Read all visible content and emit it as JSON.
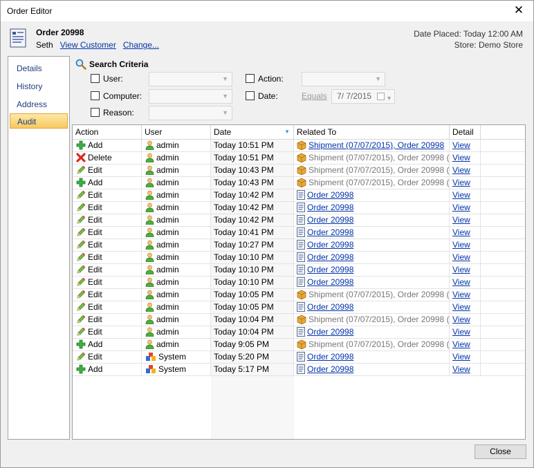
{
  "window": {
    "title": "Order Editor",
    "close_glyph": "✕"
  },
  "header": {
    "order_title": "Order 20998",
    "customer_name": "Seth",
    "view_customer": "View Customer",
    "change": "Change...",
    "date_placed": "Date Placed: Today 12:00 AM",
    "store": "Store: Demo Store",
    "icon": "order-document-icon"
  },
  "nav": {
    "items": [
      {
        "label": "Details",
        "active": false
      },
      {
        "label": "History",
        "active": false
      },
      {
        "label": "Address",
        "active": false
      },
      {
        "label": "Audit",
        "active": true
      }
    ]
  },
  "search": {
    "title": "Search Criteria",
    "icon": "magnifier-icon",
    "user_label": "User:",
    "computer_label": "Computer:",
    "reason_label": "Reason:",
    "action_label": "Action:",
    "date_label": "Date:",
    "date_operator": "Equals",
    "date_value": "7/ 7/2015"
  },
  "grid": {
    "columns": [
      "Action",
      "User",
      "Date",
      "Related To",
      "Detail"
    ],
    "sorted_column": "Date",
    "rows": [
      {
        "action": "Add",
        "action_icon": "add-icon",
        "user": "admin",
        "user_icon": "user-icon",
        "date": "Today 10:51 PM",
        "related": "Shipment (07/07/2015), Order 20998",
        "related_icon": "shipment-box-icon",
        "related_link": true,
        "detail": "View"
      },
      {
        "action": "Delete",
        "action_icon": "delete-icon",
        "user": "admin",
        "user_icon": "user-icon",
        "date": "Today 10:51 PM",
        "related": "Shipment (07/07/2015), Order 20998 (...",
        "related_icon": "shipment-box-icon",
        "related_link": false,
        "detail": "View"
      },
      {
        "action": "Edit",
        "action_icon": "edit-pencil-icon",
        "user": "admin",
        "user_icon": "user-icon",
        "date": "Today 10:43 PM",
        "related": "Shipment (07/07/2015), Order 20998 (...",
        "related_icon": "shipment-box-icon",
        "related_link": false,
        "detail": "View"
      },
      {
        "action": "Add",
        "action_icon": "add-icon",
        "user": "admin",
        "user_icon": "user-icon",
        "date": "Today 10:43 PM",
        "related": "Shipment (07/07/2015), Order 20998 (...",
        "related_icon": "shipment-box-icon",
        "related_link": false,
        "detail": "View"
      },
      {
        "action": "Edit",
        "action_icon": "edit-pencil-icon",
        "user": "admin",
        "user_icon": "user-icon",
        "date": "Today 10:42 PM",
        "related": "Order 20998",
        "related_icon": "order-document-icon",
        "related_link": true,
        "detail": "View"
      },
      {
        "action": "Edit",
        "action_icon": "edit-pencil-icon",
        "user": "admin",
        "user_icon": "user-icon",
        "date": "Today 10:42 PM",
        "related": "Order 20998",
        "related_icon": "order-document-icon",
        "related_link": true,
        "detail": "View"
      },
      {
        "action": "Edit",
        "action_icon": "edit-pencil-icon",
        "user": "admin",
        "user_icon": "user-icon",
        "date": "Today 10:42 PM",
        "related": "Order 20998",
        "related_icon": "order-document-icon",
        "related_link": true,
        "detail": "View"
      },
      {
        "action": "Edit",
        "action_icon": "edit-pencil-icon",
        "user": "admin",
        "user_icon": "user-icon",
        "date": "Today 10:41 PM",
        "related": "Order 20998",
        "related_icon": "order-document-icon",
        "related_link": true,
        "detail": "View"
      },
      {
        "action": "Edit",
        "action_icon": "edit-pencil-icon",
        "user": "admin",
        "user_icon": "user-icon",
        "date": "Today 10:27 PM",
        "related": "Order 20998",
        "related_icon": "order-document-icon",
        "related_link": true,
        "detail": "View"
      },
      {
        "action": "Edit",
        "action_icon": "edit-pencil-icon",
        "user": "admin",
        "user_icon": "user-icon",
        "date": "Today 10:10 PM",
        "related": "Order 20998",
        "related_icon": "order-document-icon",
        "related_link": true,
        "detail": "View"
      },
      {
        "action": "Edit",
        "action_icon": "edit-pencil-icon",
        "user": "admin",
        "user_icon": "user-icon",
        "date": "Today 10:10 PM",
        "related": "Order 20998",
        "related_icon": "order-document-icon",
        "related_link": true,
        "detail": "View"
      },
      {
        "action": "Edit",
        "action_icon": "edit-pencil-icon",
        "user": "admin",
        "user_icon": "user-icon",
        "date": "Today 10:10 PM",
        "related": "Order 20998",
        "related_icon": "order-document-icon",
        "related_link": true,
        "detail": "View"
      },
      {
        "action": "Edit",
        "action_icon": "edit-pencil-icon",
        "user": "admin",
        "user_icon": "user-icon",
        "date": "Today 10:05 PM",
        "related": "Shipment (07/07/2015), Order 20998 (...",
        "related_icon": "shipment-box-icon",
        "related_link": false,
        "detail": "View"
      },
      {
        "action": "Edit",
        "action_icon": "edit-pencil-icon",
        "user": "admin",
        "user_icon": "user-icon",
        "date": "Today 10:05 PM",
        "related": "Order 20998",
        "related_icon": "order-document-icon",
        "related_link": true,
        "detail": "View"
      },
      {
        "action": "Edit",
        "action_icon": "edit-pencil-icon",
        "user": "admin",
        "user_icon": "user-icon",
        "date": "Today 10:04 PM",
        "related": "Shipment (07/07/2015), Order 20998 (...",
        "related_icon": "shipment-box-icon",
        "related_link": false,
        "detail": "View"
      },
      {
        "action": "Edit",
        "action_icon": "edit-pencil-icon",
        "user": "admin",
        "user_icon": "user-icon",
        "date": "Today 10:04 PM",
        "related": "Order 20998",
        "related_icon": "order-document-icon",
        "related_link": true,
        "detail": "View"
      },
      {
        "action": "Add",
        "action_icon": "add-icon",
        "user": "admin",
        "user_icon": "user-icon",
        "date": "Today 9:05 PM",
        "related": "Shipment (07/07/2015), Order 20998 (...",
        "related_icon": "shipment-box-icon",
        "related_link": false,
        "detail": "View"
      },
      {
        "action": "Edit",
        "action_icon": "edit-pencil-icon",
        "user": "System",
        "user_icon": "system-icon",
        "date": "Today 5:20 PM",
        "related": "Order 20998",
        "related_icon": "order-document-icon",
        "related_link": true,
        "detail": "View"
      },
      {
        "action": "Add",
        "action_icon": "add-icon",
        "user": "System",
        "user_icon": "system-icon",
        "date": "Today 5:17 PM",
        "related": "Order 20998",
        "related_icon": "order-document-icon",
        "related_link": true,
        "detail": "View"
      }
    ]
  },
  "footer": {
    "close_label": "Close"
  },
  "colors": {
    "link": "#0033aa",
    "nav_active": "#f7c85e",
    "sorted_column_bg": "#f7f7f7"
  }
}
